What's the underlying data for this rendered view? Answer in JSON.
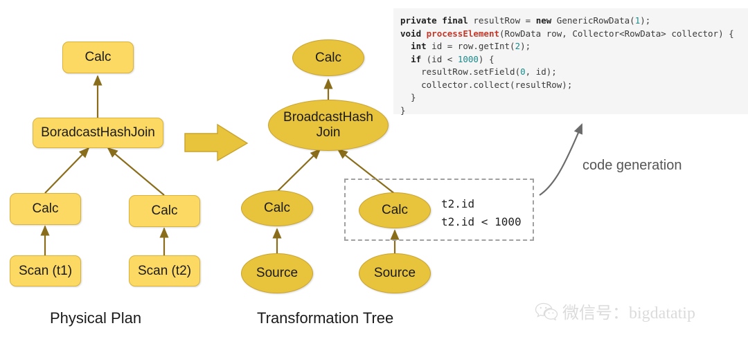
{
  "code_panel": {
    "language": "java",
    "lines": [
      "private final resultRow = new GenericRowData(1);",
      "void processElement(RowData row, Collector<RowData> collector) {",
      "  int id = row.getInt(2);",
      "  if (id < 1000) {",
      "    resultRow.setField(0, id);",
      "    collector.collect(resultRow);",
      "  }",
      "}"
    ],
    "background": "#f5f5f5",
    "keyword_color": "#1f1f1f",
    "method_color": "#c0392b",
    "number_color": "#1a8a8a"
  },
  "physical_plan": {
    "caption": "Physical Plan",
    "nodes": {
      "root_calc": "Calc",
      "join": "BoradcastHashJoin",
      "left_calc": "Calc",
      "right_calc": "Calc",
      "left_scan": "Scan (t1)",
      "right_scan": "Scan (t2)"
    }
  },
  "transformation_tree": {
    "caption": "Transformation Tree",
    "nodes": {
      "root_calc": "Calc",
      "join_line1": "BroadcastHash",
      "join_line2": "Join",
      "left_calc": "Calc",
      "right_calc": "Calc",
      "left_source": "Source",
      "right_source": "Source"
    }
  },
  "annotation": {
    "expr_line1": "t2.id",
    "expr_line2": "t2.id < 1000",
    "border_color": "#a0a0a0"
  },
  "codegen": {
    "label": "code generation",
    "arrow_color": "#6b6b6b"
  },
  "big_arrow": {
    "fill": "#e8c33c",
    "stroke": "#c9a32e"
  },
  "watermark": {
    "text": "微信号：bigdatatip",
    "icon": "wechat-icon"
  },
  "palette": {
    "box_fill": "#fcd963",
    "box_stroke": "#d8b23c",
    "ellipse_fill": "#e8c33c",
    "ellipse_stroke": "#c9a32e",
    "edge_color": "#8a6d1a",
    "text_color": "#1a1a1a"
  }
}
